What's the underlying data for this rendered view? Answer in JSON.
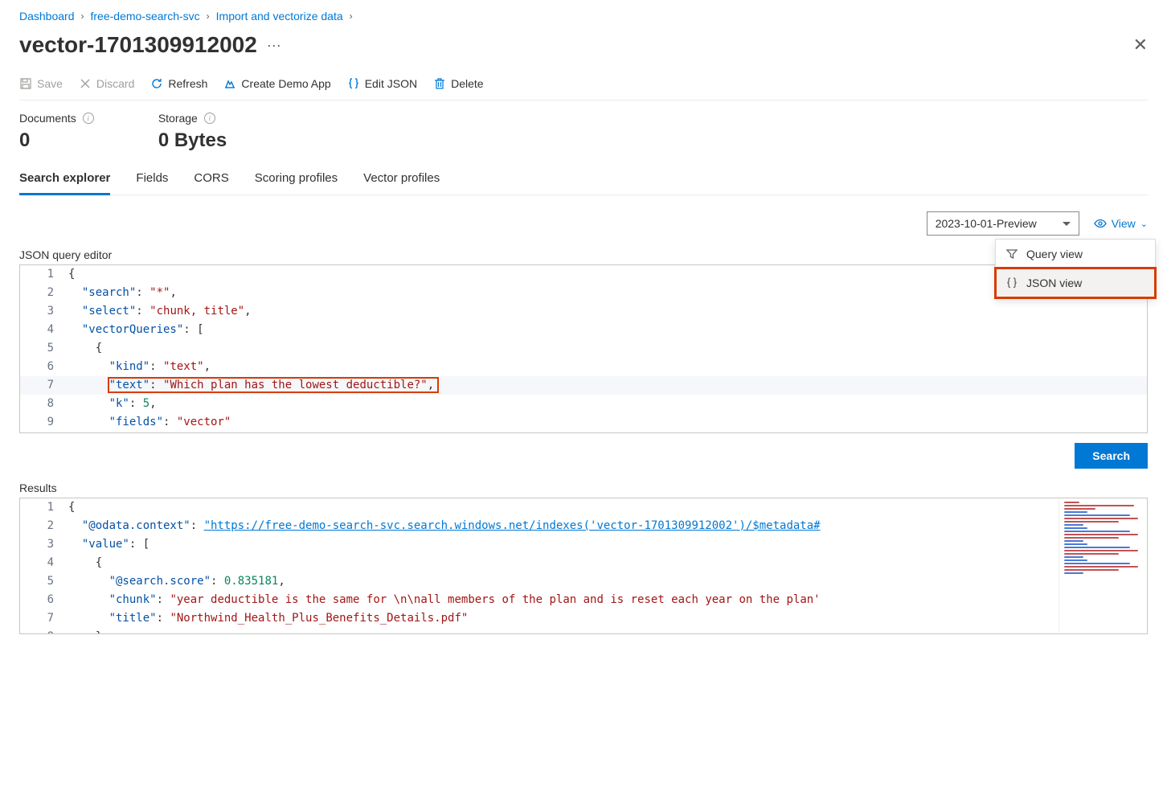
{
  "breadcrumb": {
    "dashboard": "Dashboard",
    "service": "free-demo-search-svc",
    "import": "Import and vectorize data"
  },
  "title": "vector-1701309912002",
  "toolbar": {
    "save": "Save",
    "discard": "Discard",
    "refresh": "Refresh",
    "createDemo": "Create Demo App",
    "editJson": "Edit JSON",
    "delete": "Delete"
  },
  "stats": {
    "documentsLabel": "Documents",
    "documentsValue": "0",
    "storageLabel": "Storage",
    "storageValue": "0 Bytes"
  },
  "tabs": {
    "searchExplorer": "Search explorer",
    "fields": "Fields",
    "cors": "CORS",
    "scoring": "Scoring profiles",
    "vector": "Vector profiles"
  },
  "apiVersion": "2023-10-01-Preview",
  "viewLabel": "View",
  "viewMenu": {
    "query": "Query view",
    "json": "JSON view"
  },
  "editorLabel": "JSON query editor",
  "searchButton": "Search",
  "resultsLabel": "Results",
  "query": {
    "l1": "{",
    "l2k": "\"search\"",
    "l2v": "\"*\"",
    "l3k": "\"select\"",
    "l3v": "\"chunk, title\"",
    "l4k": "\"vectorQueries\"",
    "l5": "    {",
    "l6k": "\"kind\"",
    "l6v": "\"text\"",
    "l7k": "\"text\"",
    "l7v": "\"Which plan has the lowest deductible?\"",
    "l8k": "\"k\"",
    "l8v": "5",
    "l9k": "\"fields\"",
    "l9v": "\"vector\""
  },
  "results": {
    "l1": "{",
    "l2k": "\"@odata.context\"",
    "l2v": "\"https://free-demo-search-svc.search.windows.net/indexes('vector-1701309912002')/$metadata#",
    "l3k": "\"value\"",
    "l4": "    {",
    "l5k": "\"@search.score\"",
    "l5v": "0.835181",
    "l6k": "\"chunk\"",
    "l6v": "\"year deductible is the same for \\n\\nall members of the plan and is reset each year on the plan'",
    "l7k": "\"title\"",
    "l7v": "\"Northwind_Health_Plus_Benefits_Details.pdf\"",
    "l8": "    },"
  }
}
